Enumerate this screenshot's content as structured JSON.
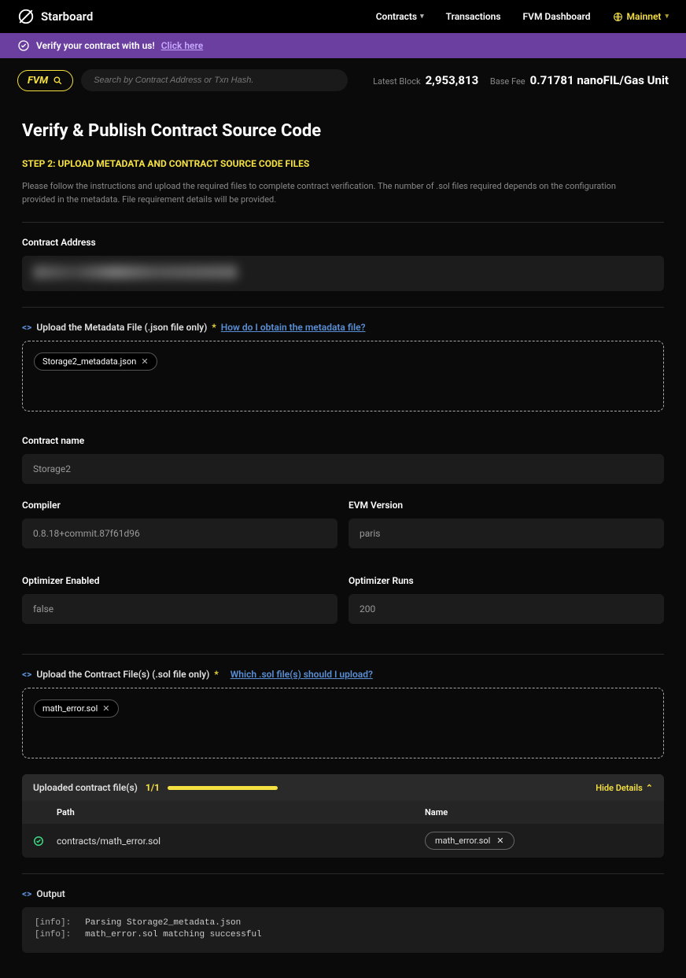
{
  "header": {
    "brand": "Starboard",
    "nav": {
      "contracts": "Contracts",
      "transactions": "Transactions",
      "fvm_dashboard": "FVM Dashboard"
    },
    "network": "Mainnet"
  },
  "banner": {
    "text": "Verify your contract with us!",
    "link": "Click here"
  },
  "toolbar": {
    "fvm": "FVM",
    "search_placeholder": "Search by Contract Address or Txn Hash.",
    "latest_block_label": "Latest Block",
    "latest_block_value": "2,953,813",
    "base_fee_label": "Base Fee",
    "base_fee_value": "0.71781 nanoFIL/Gas Unit"
  },
  "page": {
    "title": "Verify & Publish Contract Source Code",
    "step": "STEP 2: UPLOAD METADATA AND CONTRACT SOURCE CODE FILES",
    "desc": "Please follow the instructions and upload the required files to complete contract verification. The number of .sol files required depends on the configuration provided in the metadata. File requirement details will be provided.",
    "contract_address_label": "Contract Address",
    "metadata": {
      "label": "Upload the Metadata File (.json file only)",
      "help": "How do I obtain the metadata file?",
      "chip": "Storage2_metadata.json"
    },
    "fields": {
      "contract_name_label": "Contract name",
      "contract_name_value": "Storage2",
      "compiler_label": "Compiler",
      "compiler_value": "0.8.18+commit.87f61d96",
      "evm_label": "EVM Version",
      "evm_value": "paris",
      "opt_enabled_label": "Optimizer Enabled",
      "opt_enabled_value": "false",
      "opt_runs_label": "Optimizer Runs",
      "opt_runs_value": "200"
    },
    "contracts_upload": {
      "label": "Upload the Contract File(s) (.sol file only)",
      "help": "Which .sol file(s) should I upload?",
      "chip": "math_error.sol"
    },
    "uploaded": {
      "label": "Uploaded contract file(s)",
      "count": "1/1",
      "hide": "Hide Details",
      "col_path": "Path",
      "col_name": "Name",
      "row_path": "contracts/math_error.sol",
      "row_name": "math_error.sol"
    },
    "output": {
      "label": "Output",
      "lines": [
        {
          "tag": "[info]:",
          "msg": "Parsing Storage2_metadata.json"
        },
        {
          "tag": "[info]:",
          "msg": "math_error.sol matching successful"
        }
      ]
    }
  }
}
